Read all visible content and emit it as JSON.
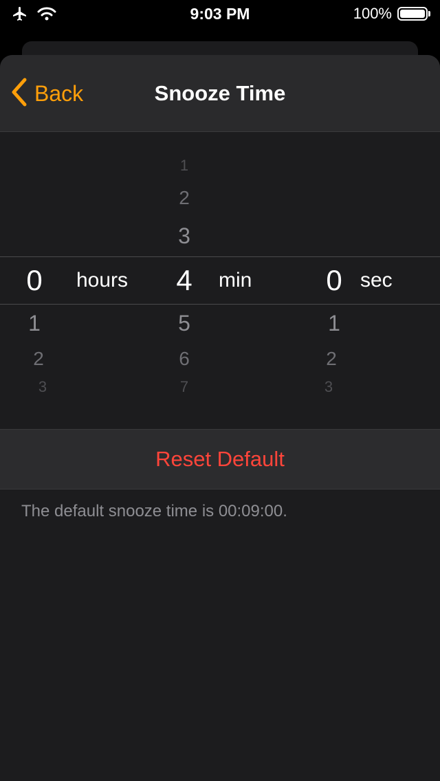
{
  "status_bar": {
    "time": "9:03 PM",
    "battery_percent": "100%",
    "icons": [
      "airplane-icon",
      "wifi-icon",
      "battery-icon"
    ]
  },
  "nav": {
    "back_label": "Back",
    "title": "Snooze Time"
  },
  "picker": {
    "hours": {
      "above": [
        "",
        ""
      ],
      "selected": "0",
      "below": [
        "1",
        "2",
        "3"
      ],
      "unit": "hours"
    },
    "minutes": {
      "above": [
        "1",
        "2",
        "3"
      ],
      "selected": "4",
      "below": [
        "5",
        "6",
        "7"
      ],
      "unit": "min"
    },
    "seconds": {
      "above": [
        "",
        ""
      ],
      "selected": "0",
      "below": [
        "1",
        "2",
        "3"
      ],
      "unit": "sec"
    }
  },
  "reset_label": "Reset Default",
  "footer_note": "The default snooze time is 00:09:00.",
  "colors": {
    "accent": "#ff9f0a",
    "destructive": "#ff453a",
    "background": "#1c1c1e"
  }
}
